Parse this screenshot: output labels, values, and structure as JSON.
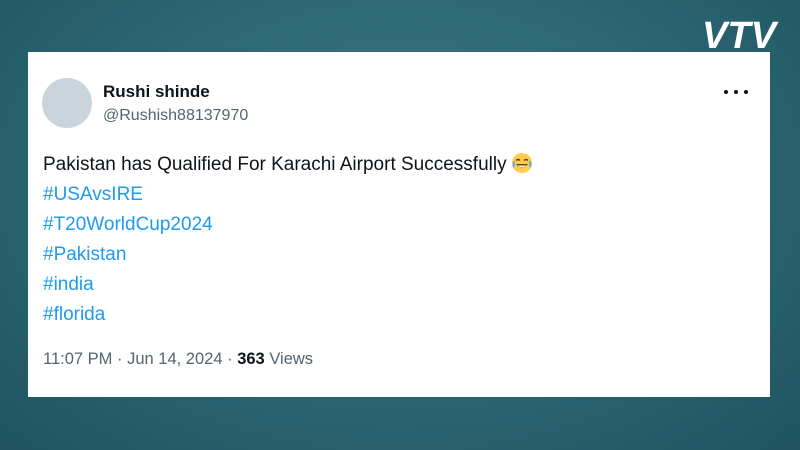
{
  "brand": {
    "logo_text": "VTV"
  },
  "tweet": {
    "display_name": "Rushi shinde",
    "handle": "@Rushish88137970",
    "text": "Pakistan has Qualified For Karachi Airport Successfully",
    "emoji": "face-with-tears-of-joy",
    "hashtags": [
      "#USAvsIRE",
      "#T20WorldCup2024",
      "#Pakistan",
      "#india",
      "#florida"
    ],
    "time": "11:07 PM",
    "separator": "·",
    "date": "Jun 14, 2024",
    "views_count": "363",
    "views_label": "Views"
  },
  "colors": {
    "background": "#2e6a76",
    "hashtag": "#1d9bf0",
    "muted_text": "#536471",
    "text": "#0f1419"
  }
}
